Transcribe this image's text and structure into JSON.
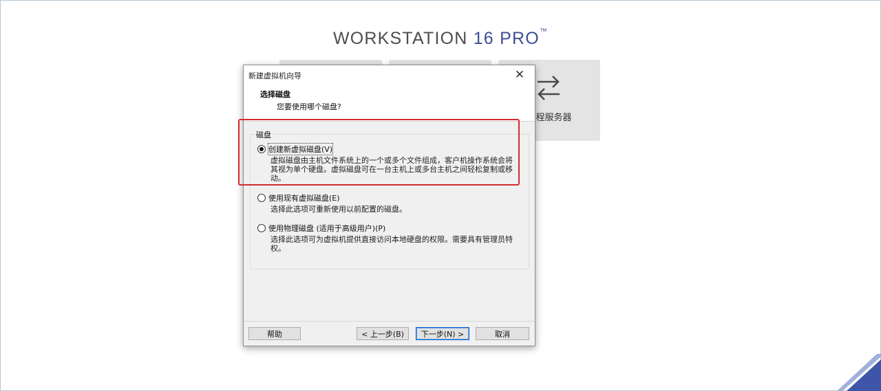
{
  "brand": {
    "name": "WORKSTATION",
    "version": "16",
    "edition": "PRO",
    "tm": "™"
  },
  "cards": {
    "remote_server_label": "远程服务器"
  },
  "dialog": {
    "title": "新建虚拟机向导",
    "header_title": "选择磁盘",
    "header_subtitle": "您要使用哪个磁盘?",
    "group_title": "磁盘",
    "options": [
      {
        "label": "创建新虚拟磁盘(V)",
        "description": "虚拟磁盘由主机文件系统上的一个或多个文件组成，客户机操作系统会将其视为单个硬盘。虚拟磁盘可在一台主机上或多台主机之间轻松复制或移动。",
        "selected": true
      },
      {
        "label": "使用现有虚拟磁盘(E)",
        "description": "选择此选项可重新使用以前配置的磁盘。",
        "selected": false
      },
      {
        "label": "使用物理磁盘 (适用于高级用户)(P)",
        "description": "选择此选项可为虚拟机提供直接访问本地硬盘的权限。需要具有管理员特权。",
        "selected": false
      }
    ],
    "buttons": {
      "help": "帮助",
      "back": "< 上一步(B)",
      "next": "下一步(N) >",
      "cancel": "取消"
    }
  },
  "icons": {
    "close": "close-icon",
    "arrows": "swap-arrows-icon"
  },
  "colors": {
    "highlight_box": "#d52a2a",
    "brand_accent": "#3d4f93"
  }
}
